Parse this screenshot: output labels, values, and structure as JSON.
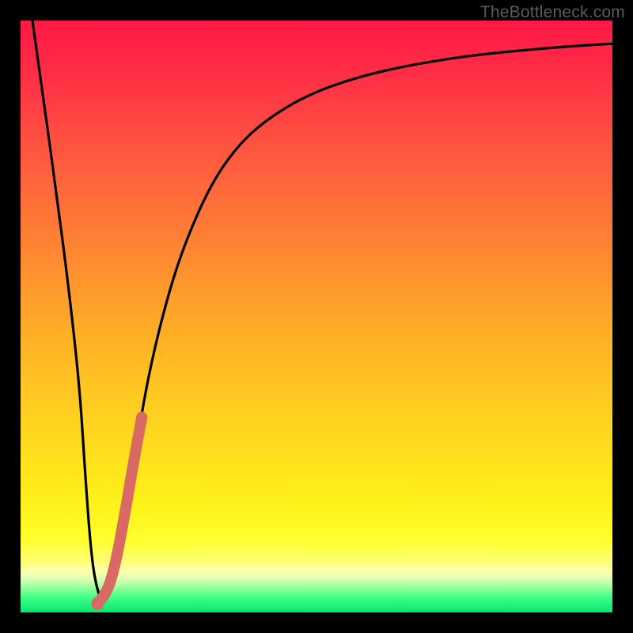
{
  "watermark": "TheBottleneck.com",
  "colors": {
    "curve": "#000000",
    "highlight": "#d96a63"
  },
  "chart_data": {
    "type": "line",
    "title": "",
    "xlabel": "",
    "ylabel": "",
    "xlim": [
      0,
      100
    ],
    "ylim": [
      0,
      100
    ],
    "grid": false,
    "series": [
      {
        "name": "bottleneck-curve",
        "x": [
          2,
          4,
          6,
          8,
          10,
          11,
          12,
          13,
          14,
          16,
          18,
          20,
          22,
          25,
          28,
          32,
          36,
          40,
          45,
          50,
          55,
          60,
          66,
          72,
          78,
          85,
          92,
          100
        ],
        "y": [
          100,
          86,
          71,
          56,
          38,
          22,
          9,
          3.5,
          1.5,
          6,
          18,
          31,
          42,
          54,
          63,
          72,
          78,
          82,
          85.5,
          88,
          89.8,
          91.2,
          92.5,
          93.5,
          94.3,
          95,
          95.6,
          96.1
        ]
      },
      {
        "name": "highlight-segment",
        "x": [
          13.2,
          14.5,
          16.0,
          17.5,
          19.2,
          20.5
        ],
        "y": [
          1.8,
          3.0,
          8.0,
          16.0,
          26.0,
          33.0
        ]
      }
    ],
    "optimal_point": {
      "x": 13,
      "y": 1.5
    },
    "annotations": []
  }
}
